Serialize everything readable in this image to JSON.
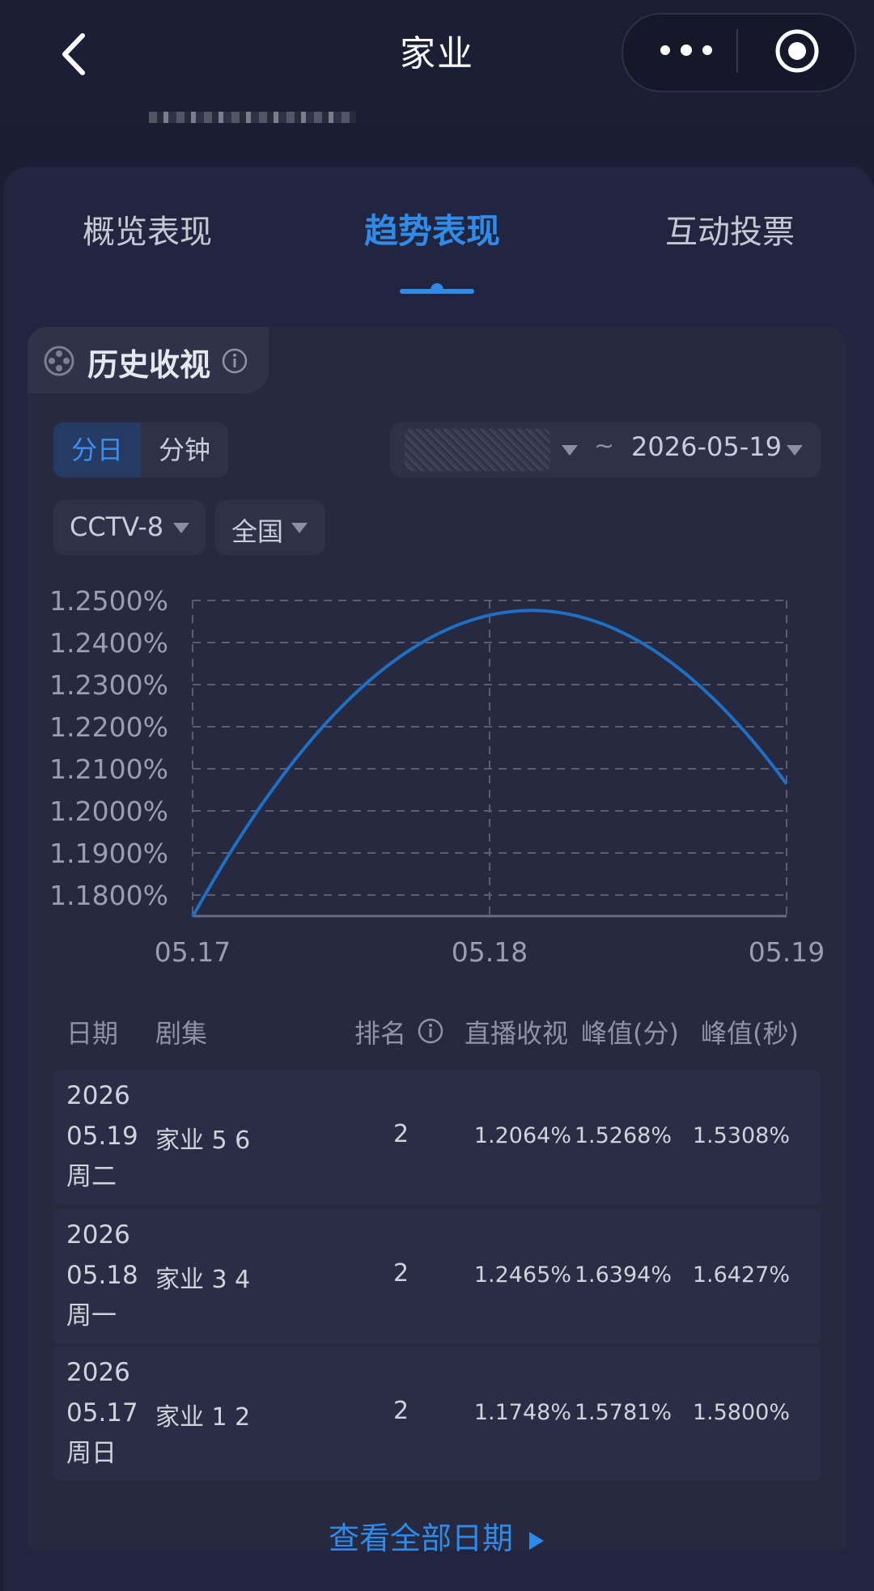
{
  "header": {
    "title": "家业"
  },
  "tabs": [
    {
      "label": "概览表现",
      "active": false
    },
    {
      "label": "趋势表现",
      "active": true
    },
    {
      "label": "互动投票",
      "active": false
    }
  ],
  "section": {
    "title": "历史收视"
  },
  "filters": {
    "granularity": [
      "分日",
      "分钟"
    ],
    "date_end": "2026-05-19",
    "date_sep": "~",
    "channel": "CCTV-8",
    "region": "全国"
  },
  "chart_data": {
    "type": "line",
    "x": [
      "05.17",
      "05.18",
      "05.19"
    ],
    "series": [
      {
        "values": [
          1.1748,
          1.2465,
          1.2064
        ]
      }
    ],
    "y_ticks": [
      "1.2500%",
      "1.2400%",
      "1.2300%",
      "1.2200%",
      "1.2100%",
      "1.2000%",
      "1.1900%",
      "1.1800%"
    ],
    "ylim": [
      1.175,
      1.25
    ],
    "grid": true,
    "color": "#1f6fc4"
  },
  "table": {
    "headers": [
      "日期",
      "剧集",
      "排名",
      "直播收视",
      "峰值(分)",
      "峰值(秒)"
    ],
    "rows": [
      {
        "year": "2026",
        "date": "05.19",
        "weekday": "周二",
        "episode": "家业 5 6",
        "rank": "2",
        "live": "1.2064%",
        "peak_min": "1.5268%",
        "peak_sec": "1.5308%"
      },
      {
        "year": "2026",
        "date": "05.18",
        "weekday": "周一",
        "episode": "家业 3 4",
        "rank": "2",
        "live": "1.2465%",
        "peak_min": "1.6394%",
        "peak_sec": "1.6427%"
      },
      {
        "year": "2026",
        "date": "05.17",
        "weekday": "周日",
        "episode": "家业 1 2",
        "rank": "2",
        "live": "1.1748%",
        "peak_min": "1.5781%",
        "peak_sec": "1.5800%"
      }
    ]
  },
  "footer": {
    "view_all": "查看全部日期"
  },
  "icons": {
    "back": "chevron-left-icon",
    "more": "more-dots-icon",
    "close": "target-circle-icon",
    "section": "film-reel-icon",
    "info": "info-icon"
  },
  "colors": {
    "accent": "#2f8ae8",
    "background": "#1a1d33"
  }
}
